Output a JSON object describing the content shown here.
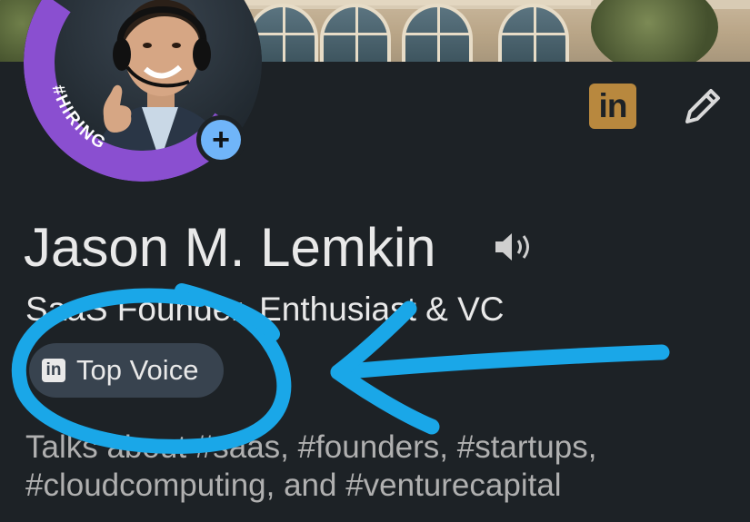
{
  "profile": {
    "name": "Jason M. Lemkin",
    "headline": "SaaS Founder, Enthusiast & VC",
    "badge_label": "Top Voice",
    "badge_icon": "in",
    "hiring_frame_text": "#HIRING",
    "talks_about": "Talks about #saas, #founders, #startups, #cloudcomputing, and #venturecapital"
  },
  "header": {
    "linkedin_icon_text": "in",
    "plus_symbol": "+"
  },
  "icons": {
    "linkedin": "linkedin-logo-icon",
    "edit": "pencil-icon",
    "speaker": "speaker-icon",
    "add": "plus-icon"
  },
  "colors": {
    "background": "#1d2226",
    "hiring_ring": "#8a4fd0",
    "plus_button": "#70b5f9",
    "linkedin_badge": "#b8883e",
    "top_voice_pill": "#38434f",
    "annotation": "#1aa7e8"
  }
}
